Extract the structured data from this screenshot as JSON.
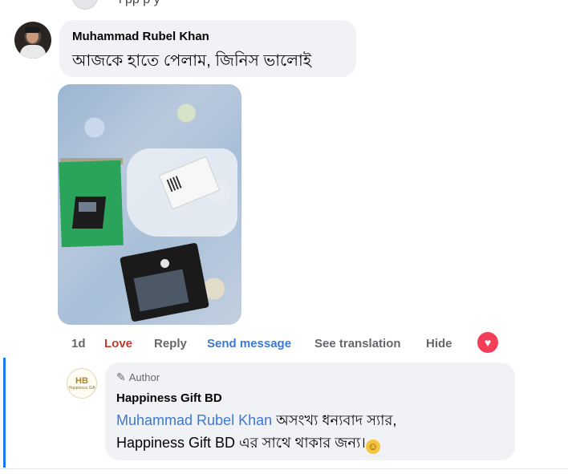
{
  "previous": {
    "cut_text": "l   pp               p      y"
  },
  "comment": {
    "author": "Muhammad Rubel Khan",
    "text": "আজকে হাতে পেলাম, জিনিস ভালোই",
    "actions": {
      "time": "1d",
      "reaction": "Love",
      "reply": "Reply",
      "send_message": "Send message",
      "see_translation": "See translation",
      "hide": "Hide"
    },
    "reaction_icon": "heart-icon"
  },
  "reply": {
    "badge": "Author",
    "badge_icon": "pen-icon",
    "page_name": "Happiness Gift BD",
    "avatar_initials": "HB",
    "avatar_sub": "Happiness Gift",
    "mention": "Muhammad Rubel Khan",
    "text_line1": " অসংখ্য ধন্যবাদ স্যার,",
    "text_line2": "Happiness Gift BD এর সাথে থাকার জন্য।",
    "emoji_icon": "smile-emoji-icon"
  },
  "colors": {
    "love": "#c0392b",
    "link": "#3b78d8",
    "thread": "#1877f2",
    "bubble": "#f0f2f5"
  }
}
